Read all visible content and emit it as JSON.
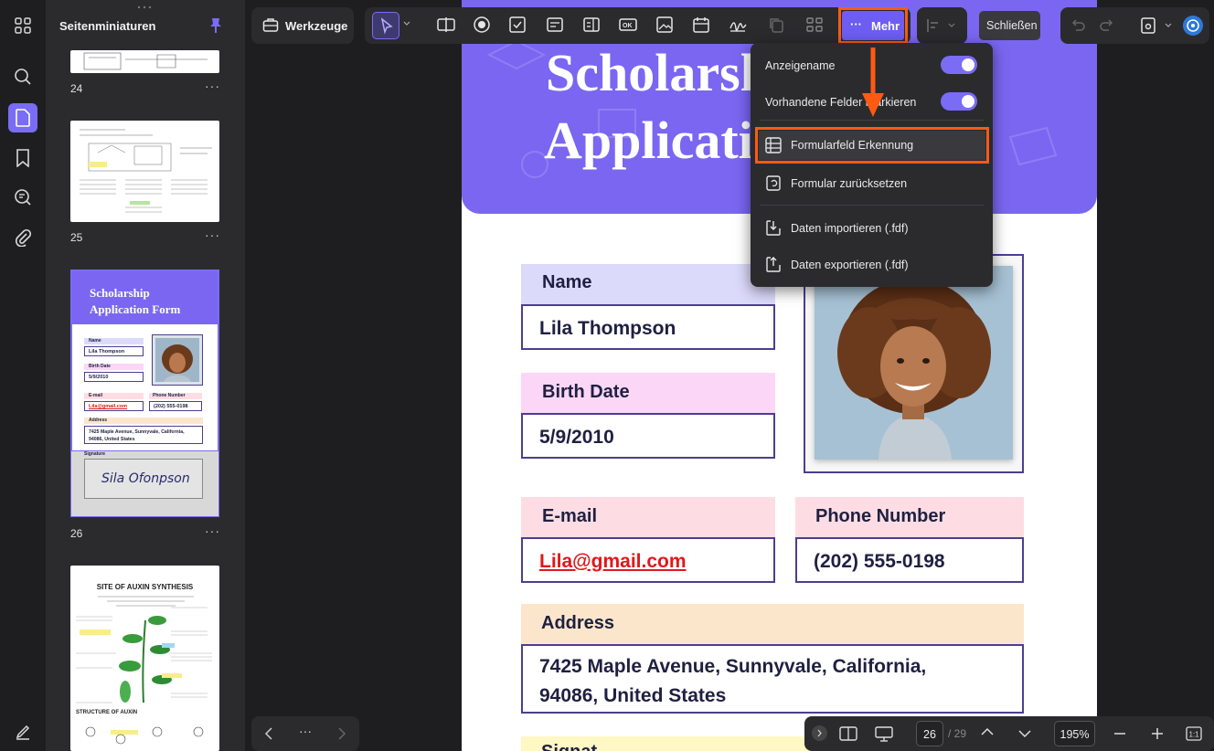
{
  "sidebar": {
    "title": "Seitenminiaturen",
    "pages": [
      {
        "num": "24"
      },
      {
        "num": "25"
      },
      {
        "num": "26"
      },
      {
        "num": ""
      }
    ],
    "more_label": "···",
    "thumb26": {
      "title_line1": "Scholarship",
      "title_line2": "Application Form",
      "name_label": "Name",
      "name_value": "Lila Thompson",
      "birth_label": "Birth Date",
      "birth_value": "5/9/2010",
      "email_label": "E-mail",
      "email_value": "Lila@gmail.com",
      "phone_label": "Phone Number",
      "phone_value": "(202) 555-0198",
      "address_label": "Address",
      "address_value1": "7425 Maple Avenue, Sunnyvale, California,",
      "address_value2": "94086, United States",
      "signature_label": "Signature",
      "signature_value": "Sila Ofonpson"
    },
    "thumb27": {
      "title": "SITE OF AUXIN SYNTHESIS",
      "bottom_label": "STRUCTURE OF AUXIN"
    }
  },
  "toolbar": {
    "tools_label": "Werkzeuge",
    "more_label": "Mehr",
    "close_label": "Schließen"
  },
  "document": {
    "header_line1": "Scholarsh",
    "header_line2": "Applicati",
    "name_label": "Name",
    "name_value": "Lila Thompson",
    "birth_label": "Birth Date",
    "birth_value": "5/9/2010",
    "email_label": "E-mail",
    "email_value": "Lila@gmail.com",
    "phone_label": "Phone Number",
    "phone_value": "(202) 555-0198",
    "address_label": "Address",
    "address_line1": "7425 Maple Avenue, Sunnyvale, California,",
    "address_line2": "94086, United States",
    "next_label": "Signat"
  },
  "menu": {
    "items": [
      {
        "label": "Anzeigename"
      },
      {
        "label": "Vorhandene Felder markieren"
      },
      {
        "label": "Formularfeld Erkennung"
      },
      {
        "label": "Formular zurücksetzen"
      },
      {
        "label": "Daten importieren (.fdf)"
      },
      {
        "label": "Daten exportieren (.fdf)"
      }
    ]
  },
  "bottom": {
    "page_current": "26",
    "page_total": "/ 29",
    "zoom": "195%"
  },
  "colors": {
    "accent": "#7a6cf5",
    "highlight": "#ff5a14",
    "header_purple": "#7b66f2"
  }
}
